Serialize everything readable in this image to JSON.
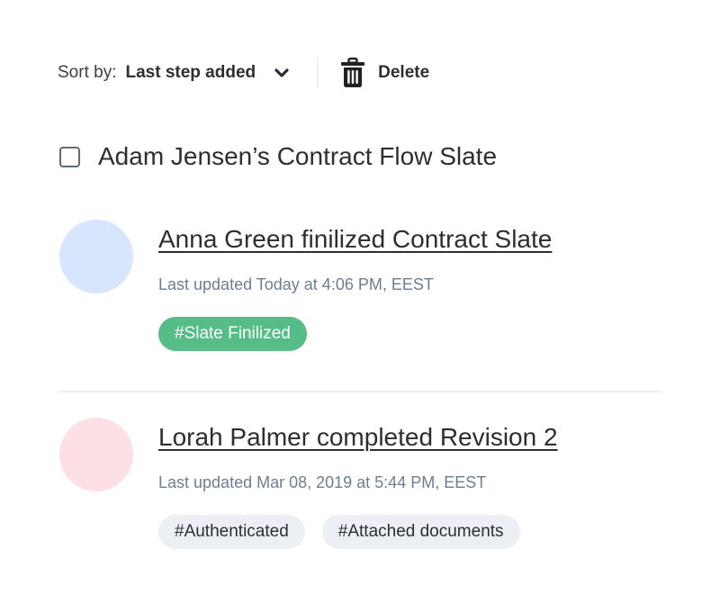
{
  "toolbar": {
    "sort_label": "Sort by:",
    "sort_value": "Last step added",
    "sort_icon": "chevron-down-icon",
    "delete_icon": "trash-icon",
    "delete_label": "Delete"
  },
  "slate": {
    "title": "Adam Jensen’s Contract Flow Slate",
    "checked": false
  },
  "items": [
    {
      "title": "Anna Green finilized Contract Slate",
      "updated": "Last updated Today at 4:06 PM, EEST",
      "avatar_color": "#d6e6fd",
      "tags": [
        {
          "label": "#Slate Finilized",
          "style": "green",
          "color": "#55bd85"
        }
      ]
    },
    {
      "title": "Lorah Palmer completed Revision 2",
      "updated": "Last updated Mar 08, 2019 at 5:44 PM, EEST",
      "avatar_color": "#fde0e6",
      "tags": [
        {
          "label": "#Authenticated",
          "style": "gray",
          "color": "#eceff3"
        },
        {
          "label": "#Attached documents",
          "style": "gray",
          "color": "#eceff3"
        }
      ]
    }
  ]
}
